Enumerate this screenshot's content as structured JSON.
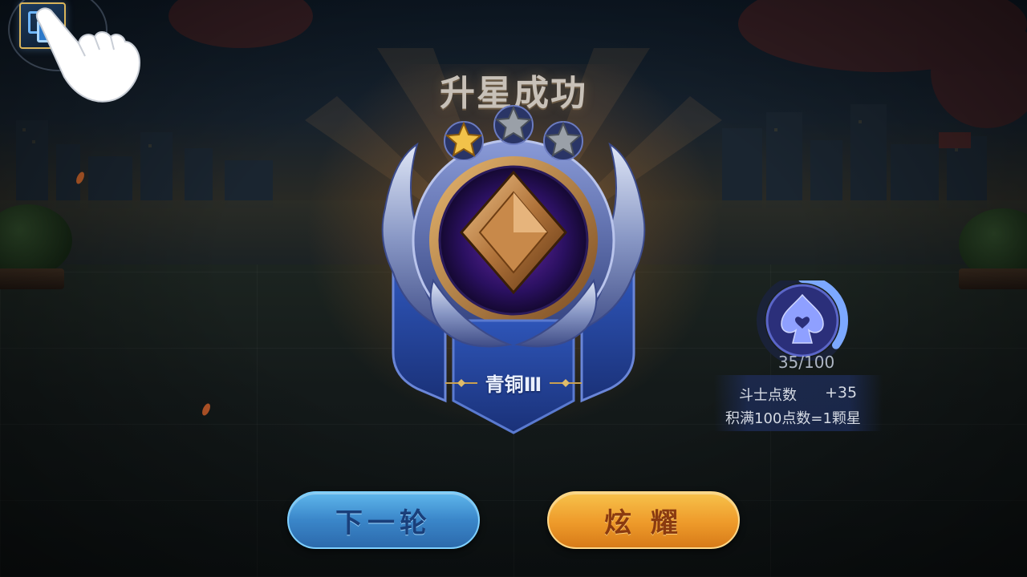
{
  "title": "升星成功",
  "rank": {
    "name": "青铜Ⅲ",
    "stars_filled": 1,
    "stars_total": 3
  },
  "points": {
    "current": "35/100",
    "progress": 0.35,
    "label": "斗士点数",
    "gain": "+35",
    "rule": "积满100点数=1颗星"
  },
  "buttons": {
    "next": "下一轮",
    "share": "炫 耀"
  },
  "icons": {
    "corner": "layout-toggle-icon",
    "hand": "tap-hint-hand-icon",
    "points": "spade-heart-icon"
  },
  "colors": {
    "gold_star": "#f2c24a",
    "gray_star": "#9aa0a8",
    "next_button": "#3a86c9",
    "share_button": "#ee9a2a"
  }
}
